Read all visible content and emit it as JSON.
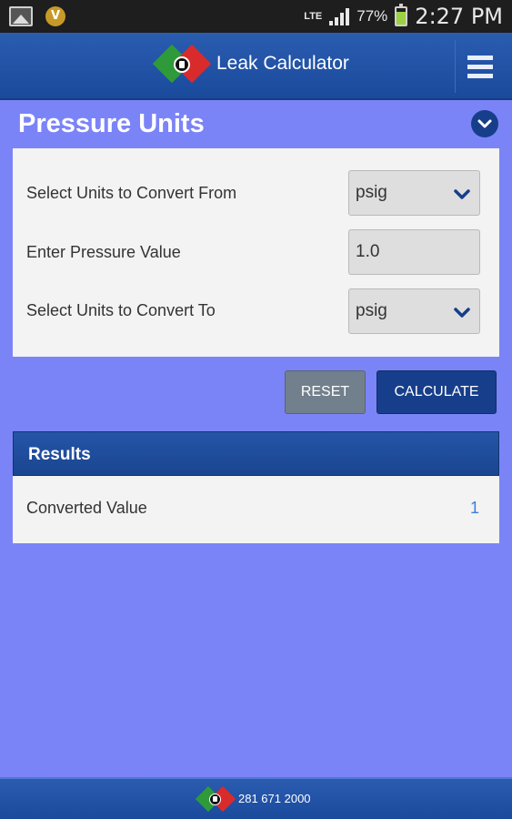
{
  "status_bar": {
    "network": "LTE",
    "battery_percent": "77%",
    "battery_level": 0.77,
    "time": "2:27 PM"
  },
  "header": {
    "title": "Leak Calculator"
  },
  "section": {
    "title": "Pressure Units"
  },
  "form": {
    "from_label": "Select Units to Convert From",
    "from_value": "psig",
    "value_label": "Enter Pressure Value",
    "value": "1.0",
    "to_label": "Select Units to Convert To",
    "to_value": "psig"
  },
  "buttons": {
    "reset": "RESET",
    "calculate": "CALCULATE"
  },
  "results": {
    "title": "Results",
    "label": "Converted Value",
    "value": "1"
  },
  "footer": {
    "phone": "281 671 2000"
  },
  "colors": {
    "background": "#7b84f7",
    "header": "#1a4a9c",
    "accent_button": "#173e8a",
    "reset_button": "#727f8d",
    "result_value": "#3b7fd8"
  },
  "icons": [
    "image-icon",
    "vendor-v-icon",
    "lte-icon",
    "signal-icon",
    "battery-icon",
    "logo-icon",
    "menu-icon",
    "chevron-down-icon"
  ]
}
